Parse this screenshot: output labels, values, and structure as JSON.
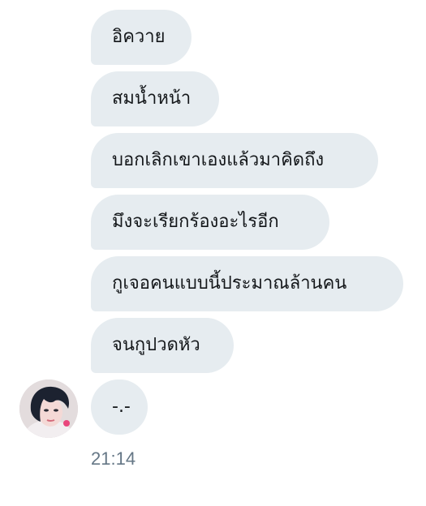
{
  "conversation": {
    "messages": [
      {
        "text": "อิควาย"
      },
      {
        "text": "สมน้ำหน้า"
      },
      {
        "text": "บอกเลิกเขาเองแล้วมาคิดถึง"
      },
      {
        "text": "มึงจะเรียกร้องอะไรอีก"
      },
      {
        "text": "กูเจอคนแบบนี้ประมาณล้านคน"
      },
      {
        "text": "จนกูปวดหัว"
      },
      {
        "text": "-.-"
      }
    ],
    "timestamp": "21:14"
  },
  "colors": {
    "bubble_background": "#e6ecf0",
    "text": "#14171a",
    "timestamp": "#657786"
  },
  "icons": {
    "sender_avatar": "profile-photo"
  }
}
